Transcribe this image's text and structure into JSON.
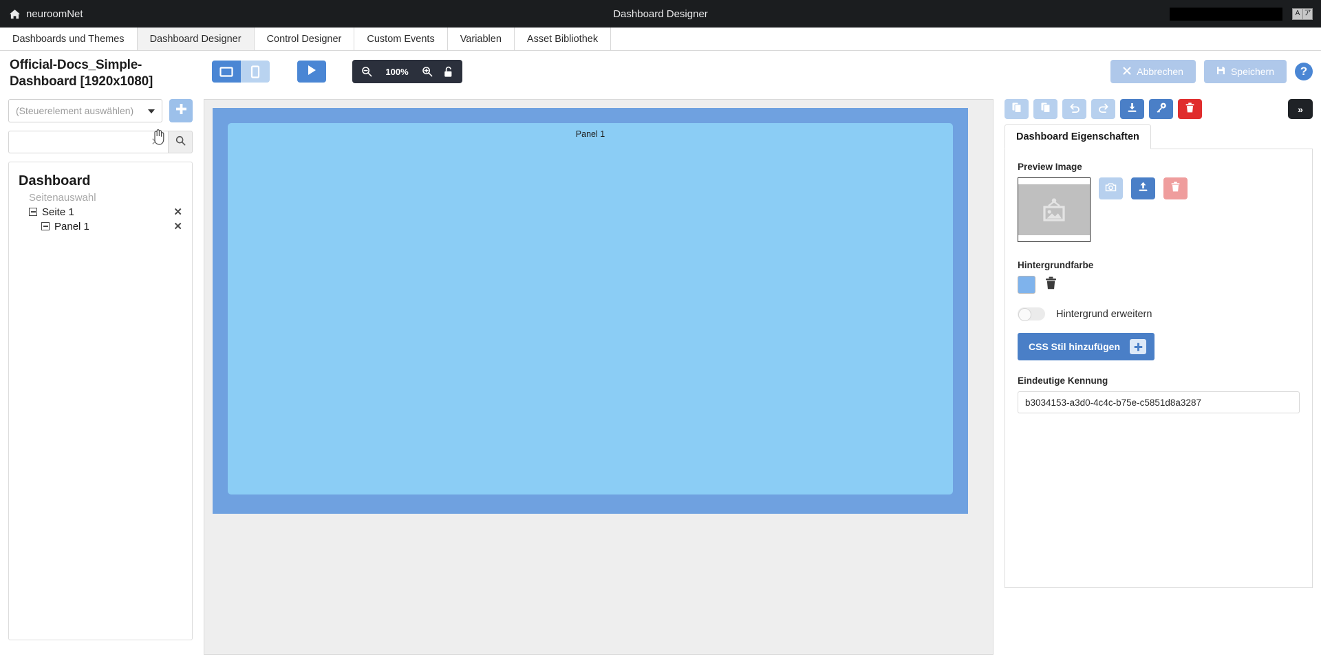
{
  "topbar": {
    "brand": "neuroomNet",
    "home_icon": "home-icon",
    "title": "Dashboard Designer",
    "lang_icon": "language-switch-icon"
  },
  "navtabs": [
    {
      "label": "Dashboards und Themes",
      "active": false
    },
    {
      "label": "Dashboard Designer",
      "active": true
    },
    {
      "label": "Control Designer",
      "active": false
    },
    {
      "label": "Custom Events",
      "active": false
    },
    {
      "label": "Variablen",
      "active": false
    },
    {
      "label": "Asset Bibliothek",
      "active": false
    }
  ],
  "toolbar": {
    "document_title": "Official-Docs_Simple-Dashboard [1920x1080]",
    "view_desktop_icon": "desktop-view-icon",
    "view_mobile_icon": "mobile-view-icon",
    "play_icon": "play-icon",
    "zoom_out_icon": "zoom-out-icon",
    "zoom_level": "100%",
    "zoom_in_icon": "zoom-in-icon",
    "lock_icon": "unlock-icon",
    "cancel_label": "Abbrechen",
    "cancel_icon": "close-icon",
    "save_label": "Speichern",
    "save_icon": "floppy-disk-icon",
    "help_label": "?"
  },
  "sidebar": {
    "control_select_placeholder": "(Steuerelement auswählen)",
    "add_icon": "plus-icon",
    "search_value": "",
    "search_placeholder": "",
    "clear_icon": "clear-icon",
    "search_icon": "search-icon",
    "tree": {
      "root": "Dashboard",
      "subtitle": "Seitenauswahl",
      "nodes": [
        {
          "label": "Seite 1",
          "indent": 0,
          "remove": "✕"
        },
        {
          "label": "Panel 1",
          "indent": 1,
          "remove": "✕"
        }
      ],
      "collapse_icon": "minus-box-icon",
      "remove_icon": "remove-icon"
    }
  },
  "canvas": {
    "panel_label": "Panel 1",
    "frame_color": "#6fa1e0",
    "panel_color": "#8bcdf5",
    "workspace_color": "#eeeeee"
  },
  "properties": {
    "toolbar_buttons": [
      {
        "name": "copy-button",
        "icon": "copy-icon",
        "style": "light"
      },
      {
        "name": "paste-button",
        "icon": "paste-icon",
        "style": "light"
      },
      {
        "name": "undo-button",
        "icon": "undo-icon",
        "style": "light"
      },
      {
        "name": "redo-button",
        "icon": "redo-icon",
        "style": "light"
      },
      {
        "name": "download-button",
        "icon": "download-icon",
        "style": "solid"
      },
      {
        "name": "key-button",
        "icon": "key-icon",
        "style": "solid"
      },
      {
        "name": "delete-button",
        "icon": "trash-icon",
        "style": "danger"
      }
    ],
    "collapse_label": "»",
    "tab_label": "Dashboard Eigenschaften",
    "preview_image_label": "Preview Image",
    "preview_buttons": [
      {
        "name": "screenshot-button",
        "icon": "camera-icon",
        "style": "light"
      },
      {
        "name": "upload-button",
        "icon": "upload-icon",
        "style": "solid"
      },
      {
        "name": "delete-preview-button",
        "icon": "trash-icon",
        "style": "red"
      }
    ],
    "background_color_label": "Hintergrundfarbe",
    "background_color_value": "#7fb3ec",
    "background_delete_icon": "trash-icon",
    "extend_background_label": "Hintergrund erweitern",
    "extend_background_on": false,
    "css_button_label": "CSS Stil hinzufügen",
    "css_button_icon": "plus-icon",
    "unique_id_label": "Eindeutige Kennung",
    "unique_id_value": "b3034153-a3d0-4c4c-b75e-c5851d8a3287"
  }
}
